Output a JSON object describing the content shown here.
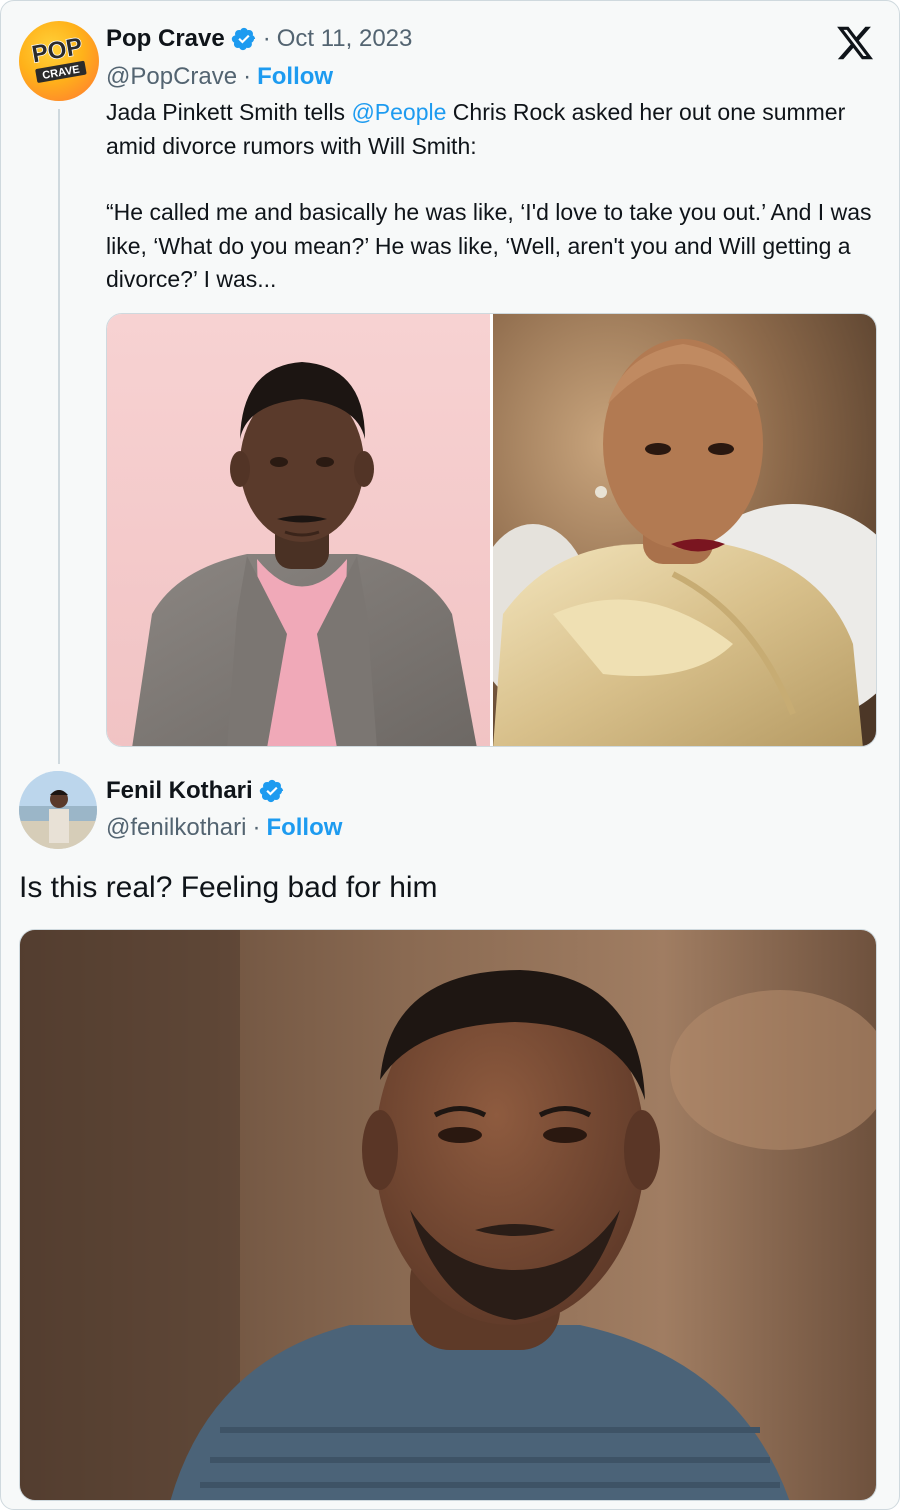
{
  "quoted_tweet": {
    "author_name": "Pop Crave",
    "date": "Oct 11, 2023",
    "handle": "@PopCrave",
    "follow_label": "Follow",
    "text_before_mention": "Jada Pinkett Smith tells ",
    "mention": "@People",
    "text_after_mention": " Chris Rock asked her out one summer amid divorce rumors with Will Smith:",
    "quote": "“He called me and basically he was like, ‘I'd love to take you out.’ And I was like, ‘What do you mean?’ He was like, ‘Well, aren't you and Will getting a divorce?’ I was...",
    "avatar_text_top": "POP",
    "avatar_text_bottom": "CRAVE"
  },
  "reply_tweet": {
    "author_name": "Fenil Kothari",
    "handle": "@fenilkothari",
    "follow_label": "Follow",
    "text": "Is this real? Feeling bad for him"
  },
  "colors": {
    "accent": "#1d9bf0",
    "text_primary": "#0f1419",
    "text_secondary": "#536471",
    "border": "#cfd9de"
  },
  "icons": {
    "verified": "verified-badge-icon",
    "brand": "x-logo-icon"
  }
}
